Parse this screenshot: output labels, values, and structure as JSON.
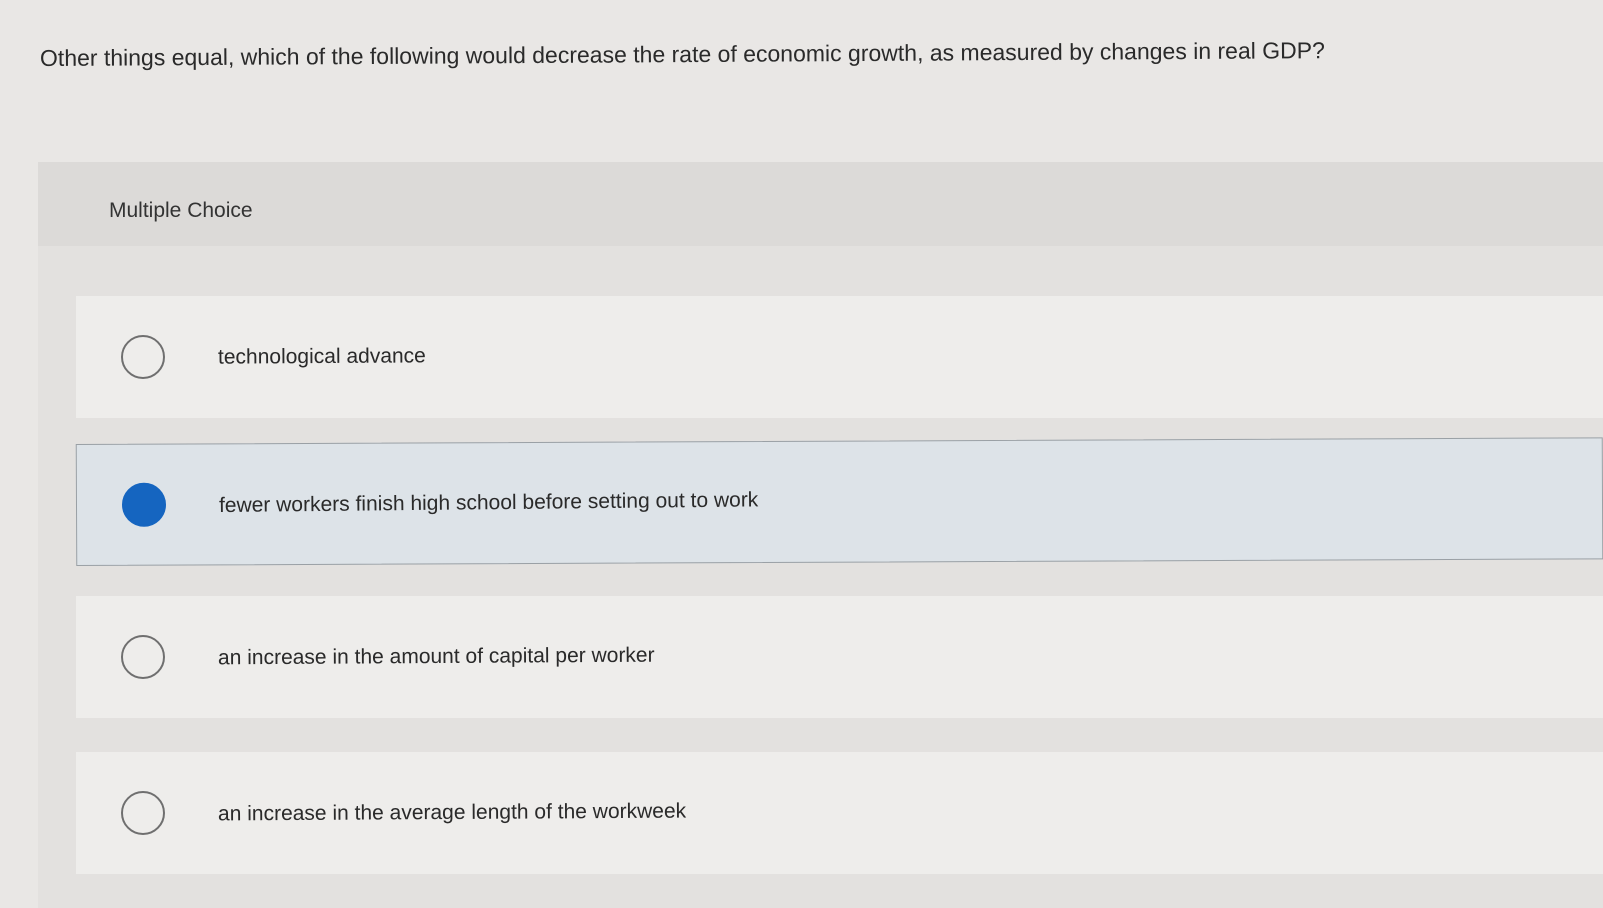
{
  "question": {
    "text": "Other things equal, which of the following would decrease the rate of economic growth, as measured by changes in real GDP?"
  },
  "multiple_choice": {
    "label": "Multiple Choice",
    "options": [
      {
        "label": "technological advance",
        "selected": false
      },
      {
        "label": "fewer workers finish high school before setting out to work",
        "selected": true
      },
      {
        "label": "an increase in the amount of capital per worker",
        "selected": false
      },
      {
        "label": "an increase in the average length of the workweek",
        "selected": false
      }
    ]
  },
  "colors": {
    "selected_radio": "#1565c0",
    "selected_option_bg": "#dde3e8",
    "panel_bg": "#e3e1df"
  }
}
